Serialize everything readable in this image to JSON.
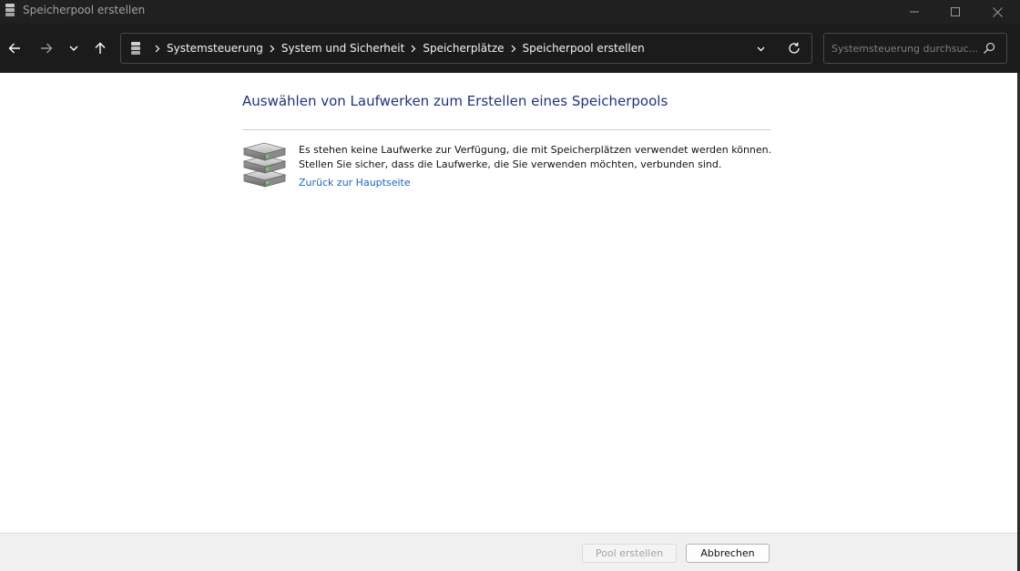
{
  "window": {
    "title": "Speicherpool erstellen"
  },
  "breadcrumb": {
    "items": [
      "Systemsteuerung",
      "System und Sicherheit",
      "Speicherplätze",
      "Speicherpool erstellen"
    ]
  },
  "search": {
    "placeholder": "Systemsteuerung durchsuc..."
  },
  "main": {
    "heading": "Auswählen von Laufwerken zum Erstellen eines Speicherpools",
    "message_line1": "Es stehen keine Laufwerke zur Verfügung, die mit Speicherplätzen verwendet werden können.",
    "message_line2": "Stellen Sie sicher, dass die Laufwerke, die Sie verwenden möchten, verbunden sind.",
    "back_link": "Zurück zur Hauptseite"
  },
  "footer": {
    "create_pool_label": "Pool erstellen",
    "cancel_label": "Abbrechen"
  },
  "colors": {
    "titlebar_bg": "#202020",
    "navbar_bg": "#1b1b1b",
    "heading": "#1e3287",
    "link": "#1a66c9"
  }
}
